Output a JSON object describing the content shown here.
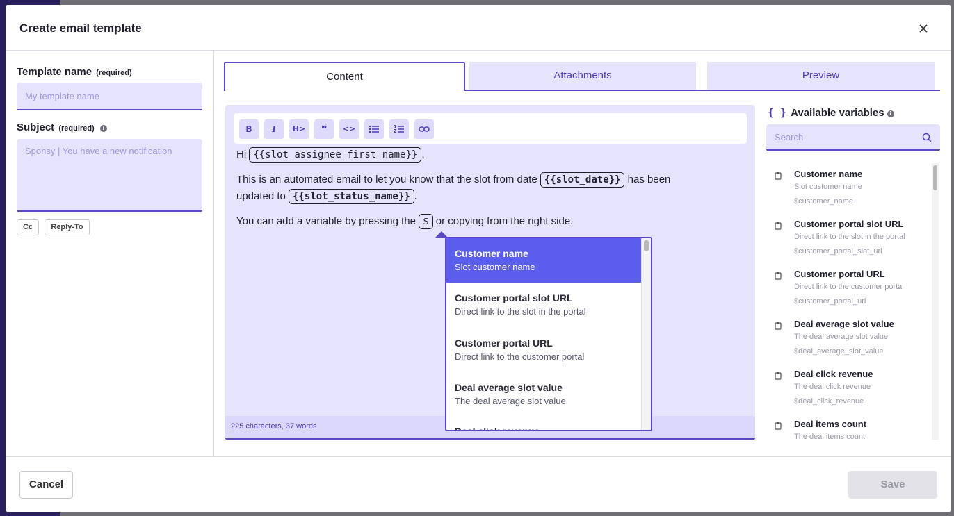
{
  "modal": {
    "title": "Create email template"
  },
  "left": {
    "template_name_label": "Template name",
    "template_name_req": "(required)",
    "template_name_placeholder": "My template name",
    "subject_label": "Subject",
    "subject_req": "(required)",
    "subject_placeholder": "Sponsy | You have a new notification",
    "cc_label": "Cc",
    "reply_to_label": "Reply-To"
  },
  "tabs": [
    {
      "label": "Content",
      "active": true
    },
    {
      "label": "Attachments",
      "active": false
    },
    {
      "label": "Preview",
      "active": false
    }
  ],
  "toolbar": {
    "bold": "B",
    "italic": "I",
    "heading": "H>",
    "quote": "❝",
    "code": "<>",
    "icons": [
      "bold-icon",
      "italic-icon",
      "heading-icon",
      "quote-icon",
      "code-icon",
      "bullet-list-icon",
      "numbered-list-icon",
      "link-icon"
    ]
  },
  "editor": {
    "line1_prefix": "Hi",
    "line1_var": "{{slot_assignee_first_name}}",
    "line1_suffix": ",",
    "line2_prefix": "This is an automated email to let you know that the slot from date",
    "line2_var": "{{slot_date}}",
    "line2_mid": "has been",
    "line3_prefix": "updated to",
    "line3_var": "{{slot_status_name}}",
    "line3_suffix": ".",
    "line4_prefix": "You can add a variable by pressing the",
    "line4_var": "$",
    "line4_suffix": "or copying from the right side.",
    "counter": "225 characters, 37 words"
  },
  "dropdown": {
    "items": [
      {
        "title": "Customer name",
        "desc": "Slot customer name",
        "selected": true
      },
      {
        "title": "Customer portal slot URL",
        "desc": "Direct link to the slot in the portal",
        "selected": false
      },
      {
        "title": "Customer portal URL",
        "desc": "Direct link to the customer portal",
        "selected": false
      },
      {
        "title": "Deal average slot value",
        "desc": "The deal average slot value",
        "selected": false
      },
      {
        "title": "Deal click revenue",
        "desc": "",
        "selected": false
      }
    ]
  },
  "variables": {
    "title": "Available variables",
    "search_placeholder": "Search",
    "items": [
      {
        "name": "Customer name",
        "desc": "Slot customer name",
        "key": "$customer_name"
      },
      {
        "name": "Customer portal slot URL",
        "desc": "Direct link to the slot in the portal",
        "key": "$customer_portal_slot_url"
      },
      {
        "name": "Customer portal URL",
        "desc": "Direct link to the customer portal",
        "key": "$customer_portal_url"
      },
      {
        "name": "Deal average slot value",
        "desc": "The deal average slot value",
        "key": "$deal_average_slot_value"
      },
      {
        "name": "Deal click revenue",
        "desc": "The deal click revenue",
        "key": "$deal_click_revenue"
      },
      {
        "name": "Deal items count",
        "desc": "The deal items count",
        "key": ""
      }
    ]
  },
  "footer": {
    "cancel_label": "Cancel",
    "save_label": "Save"
  },
  "colors": {
    "accent": "#5a48c8",
    "field_bg": "#e6e3fd",
    "selected": "#5b5ded"
  }
}
